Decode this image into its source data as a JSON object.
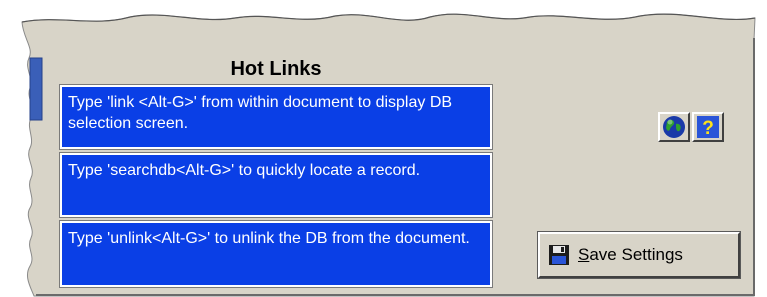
{
  "panel": {
    "title": "Hot Links",
    "hotlinks": [
      {
        "text": "Type 'link <Alt-G>' from within document to display DB selection screen."
      },
      {
        "text": "Type 'searchdb<Alt-G>'  to quickly locate a record."
      },
      {
        "text": "Type 'unlink<Alt-G>'   to unlink the DB from the document."
      }
    ]
  },
  "toolbar": {
    "globe_icon": "globe-icon",
    "help_icon": "help-icon",
    "save_icon": "floppy-disk-icon",
    "save_accel": "S",
    "save_rest": "ave Settings"
  },
  "colors": {
    "panel_bg": "#d8d4c8",
    "hotlink_bg": "#0a3fe6",
    "hotlink_text": "#ffffff",
    "side_tab": "#3a5fb8"
  }
}
